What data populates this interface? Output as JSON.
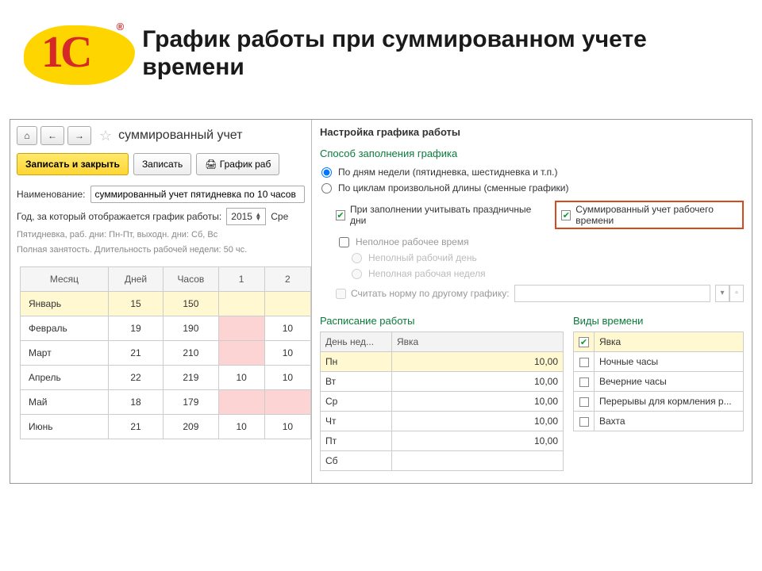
{
  "slide": {
    "title": "График работы при суммированном учете времени",
    "logo_text": "1C",
    "logo_reg": "®"
  },
  "toolbar": {
    "home_icon": "⌂",
    "back_icon": "←",
    "fwd_icon": "→",
    "star_icon": "☆",
    "doc_title": "суммированный учет",
    "save_close": "Записать и закрыть",
    "save": "Записать",
    "print": "🖨 График раб"
  },
  "fields": {
    "name_label": "Наименование:",
    "name_value": "суммированный учет пятидневка по 10 часов",
    "year_label": "Год, за который отображается график работы:",
    "year_value": "2015",
    "avg_cut": "Сре"
  },
  "desc": {
    "line1": "Пятидневка, раб. дни: Пн-Пт, выходн. дни: Сб, Вс",
    "line2": "Полная занятость. Длительность рабочей недели: 50 чс."
  },
  "months_table": {
    "headers": [
      "Месяц",
      "Дней",
      "Часов",
      "1",
      "2"
    ],
    "rows": [
      {
        "month": "Январь",
        "days": "15",
        "hours": "150",
        "d1": "",
        "d2": "",
        "hl": true,
        "pink1": false,
        "pink2": false
      },
      {
        "month": "Февраль",
        "days": "19",
        "hours": "190",
        "d1": "",
        "d2": "10",
        "hl": false,
        "pink1": true,
        "pink2": false
      },
      {
        "month": "Март",
        "days": "21",
        "hours": "210",
        "d1": "",
        "d2": "10",
        "hl": false,
        "pink1": true,
        "pink2": false
      },
      {
        "month": "Апрель",
        "days": "22",
        "hours": "219",
        "d1": "10",
        "d2": "10",
        "hl": false,
        "pink1": false,
        "pink2": false
      },
      {
        "month": "Май",
        "days": "18",
        "hours": "179",
        "d1": "",
        "d2": "",
        "hl": false,
        "pink1": true,
        "pink2": true
      },
      {
        "month": "Июнь",
        "days": "21",
        "hours": "209",
        "d1": "10",
        "d2": "10",
        "hl": false,
        "pink1": false,
        "pink2": false
      }
    ]
  },
  "settings": {
    "panel_title": "Настройка графика работы",
    "fill_method_title": "Способ заполнения графика",
    "radio_weekdays": "По дням недели (пятидневка, шестидневка и т.п.)",
    "radio_cycles": "По циклам произвольной длины (сменные графики)",
    "check_holidays": "При заполнении учитывать праздничные дни",
    "check_summarized": "Суммированный учет рабочего времени",
    "check_parttime": "Неполное рабочее время",
    "radio_partday": "Неполный рабочий день",
    "radio_partweek": "Неполная рабочая неделя",
    "check_norm": "Считать норму по другому графику:"
  },
  "schedule": {
    "title": "Расписание работы",
    "col_day": "День нед...",
    "col_attend": "Явка",
    "rows": [
      {
        "day": "Пн",
        "val": "10,00",
        "hl": true
      },
      {
        "day": "Вт",
        "val": "10,00",
        "hl": false
      },
      {
        "day": "Ср",
        "val": "10,00",
        "hl": false
      },
      {
        "day": "Чт",
        "val": "10,00",
        "hl": false
      },
      {
        "day": "Пт",
        "val": "10,00",
        "hl": false
      },
      {
        "day": "Сб",
        "val": "",
        "hl": false
      }
    ]
  },
  "types": {
    "title": "Виды времени",
    "rows": [
      {
        "label": "Явка",
        "checked": true,
        "hl": true
      },
      {
        "label": "Ночные часы",
        "checked": false,
        "hl": false
      },
      {
        "label": "Вечерние часы",
        "checked": false,
        "hl": false
      },
      {
        "label": "Перерывы для кормления р...",
        "checked": false,
        "hl": false
      },
      {
        "label": "Вахта",
        "checked": false,
        "hl": false
      }
    ]
  }
}
